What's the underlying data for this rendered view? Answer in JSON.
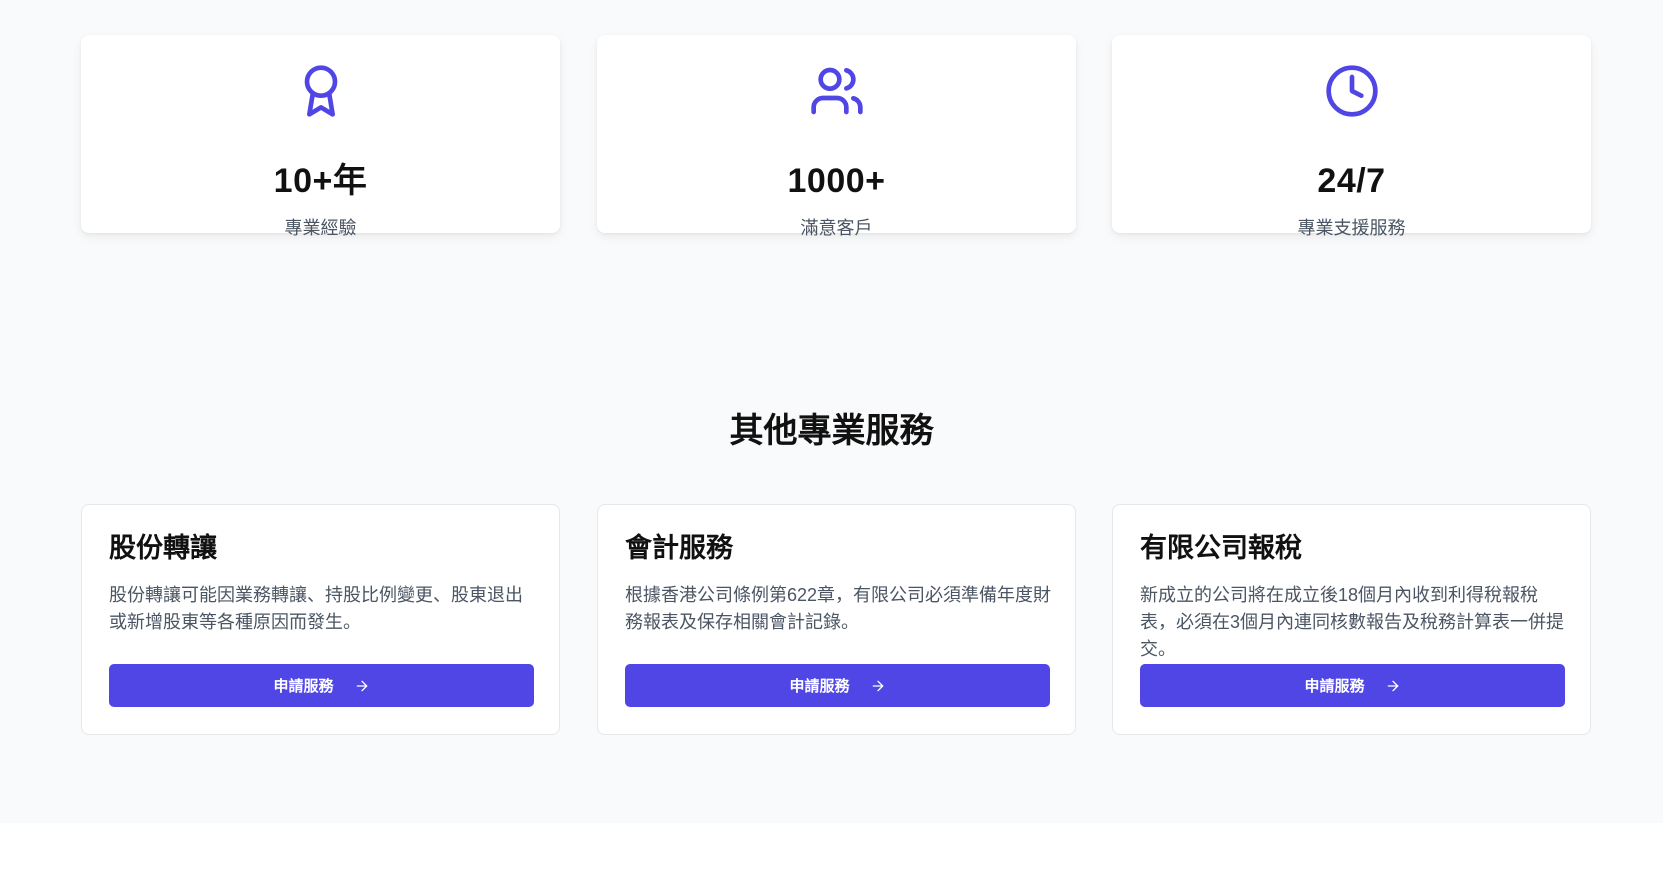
{
  "colors": {
    "accent": "#4f46e5",
    "section_background": "#f9fafb",
    "card_background": "#ffffff",
    "text_primary": "#111111",
    "text_secondary": "#4b5563"
  },
  "stats": [
    {
      "icon": "award-icon",
      "value": "10+年",
      "label": "專業經驗"
    },
    {
      "icon": "users-icon",
      "value": "1000+",
      "label": "滿意客戶"
    },
    {
      "icon": "clock-icon",
      "value": "24/7",
      "label": "專業支援服務"
    }
  ],
  "services_section": {
    "title": "其他專業服務",
    "cards": [
      {
        "title": "股份轉讓",
        "description": "股份轉讓可能因業務轉讓、持股比例變更、股東退出或新增股東等各種原因而發生。",
        "button_label": "申請服務",
        "button_icon": "arrow-right-icon"
      },
      {
        "title": "會計服務",
        "description": "根據香港公司條例第622章，有限公司必須準備年度財務報表及保存相關會計記錄。",
        "button_label": "申請服務",
        "button_icon": "arrow-right-icon"
      },
      {
        "title": "有限公司報稅",
        "description": "新成立的公司將在成立後18個月內收到利得稅報稅表，必須在3個月內連同核數報告及稅務計算表一併提交。",
        "button_label": "申請服務",
        "button_icon": "arrow-right-icon"
      }
    ]
  }
}
